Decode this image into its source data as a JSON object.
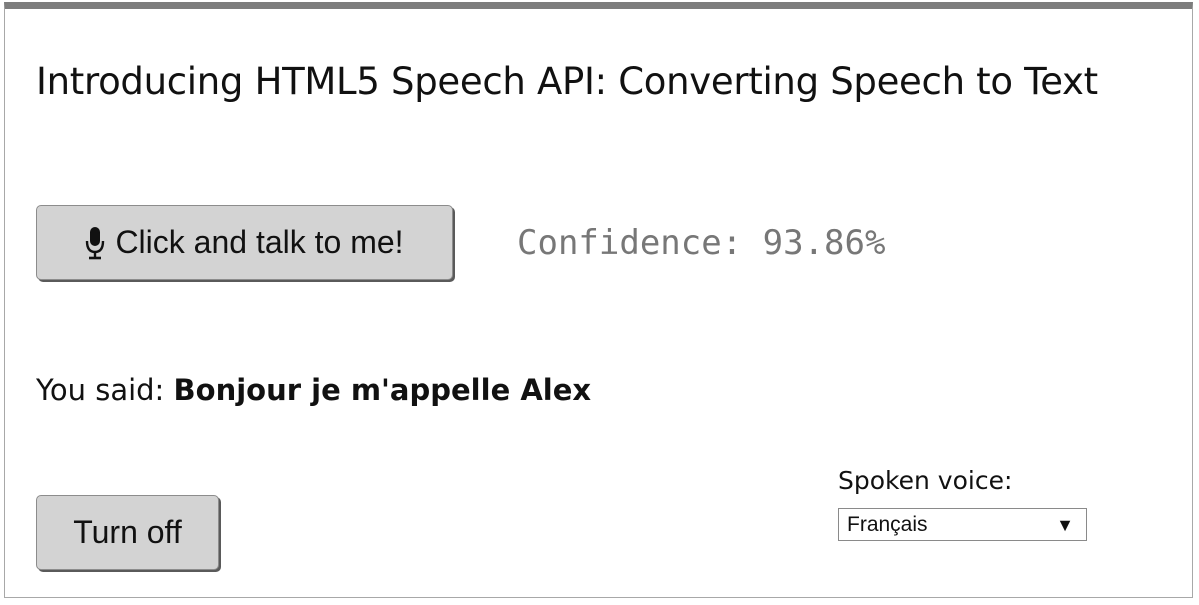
{
  "page": {
    "title": "Introducing HTML5 Speech API: Converting Speech to Text"
  },
  "talk_button": {
    "icon": "microphone-icon",
    "label": "Click and talk to me!"
  },
  "confidence_text": "Confidence: 93.86%",
  "result": {
    "prefix": "You said: ",
    "transcript": "Bonjour je m'appelle Alex"
  },
  "turn_off_button": {
    "label": "Turn off"
  },
  "voice": {
    "label": "Spoken voice:",
    "selected": "Français",
    "dropdown_icon": "triangle-down-icon"
  }
}
